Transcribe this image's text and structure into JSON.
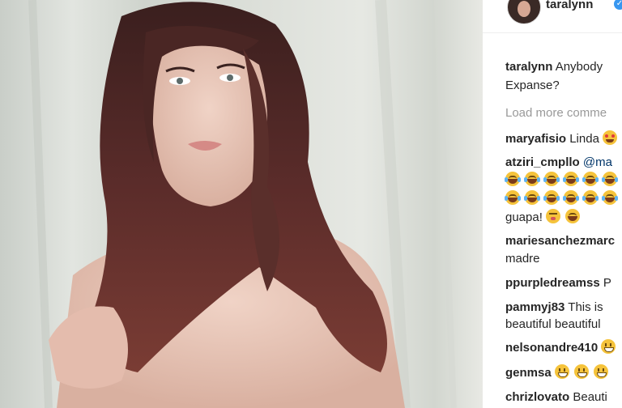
{
  "post": {
    "photo_alt_icon": "photo-woman-portrait",
    "author": "taralynn",
    "verified_icon": "verified-badge-icon",
    "colors": {
      "verified": "#3897f0",
      "mention": "#003569",
      "muted": "#999999",
      "text": "#262626"
    }
  },
  "caption": {
    "username": "taralynn",
    "text_line1": "Anybody",
    "text_line2": "Expanse?"
  },
  "load_more": "Load more comme",
  "comments": [
    {
      "username": "maryafisio",
      "text": "Linda"
    },
    {
      "username": "atziri_cmpllo",
      "mention": "@ma",
      "text_line3": "guapa!"
    },
    {
      "username": "mariesanchezmarc",
      "text_line2": "madre"
    },
    {
      "username": "ppurpledreamss",
      "text": "P"
    },
    {
      "username": "pammyj83",
      "text": "This is",
      "text_line2": "beautiful beautiful"
    },
    {
      "username": "nelsonandre410",
      "text": ""
    },
    {
      "username": "genmsa",
      "text": ""
    },
    {
      "username": "chrizlovato",
      "text": "Beauti"
    }
  ]
}
